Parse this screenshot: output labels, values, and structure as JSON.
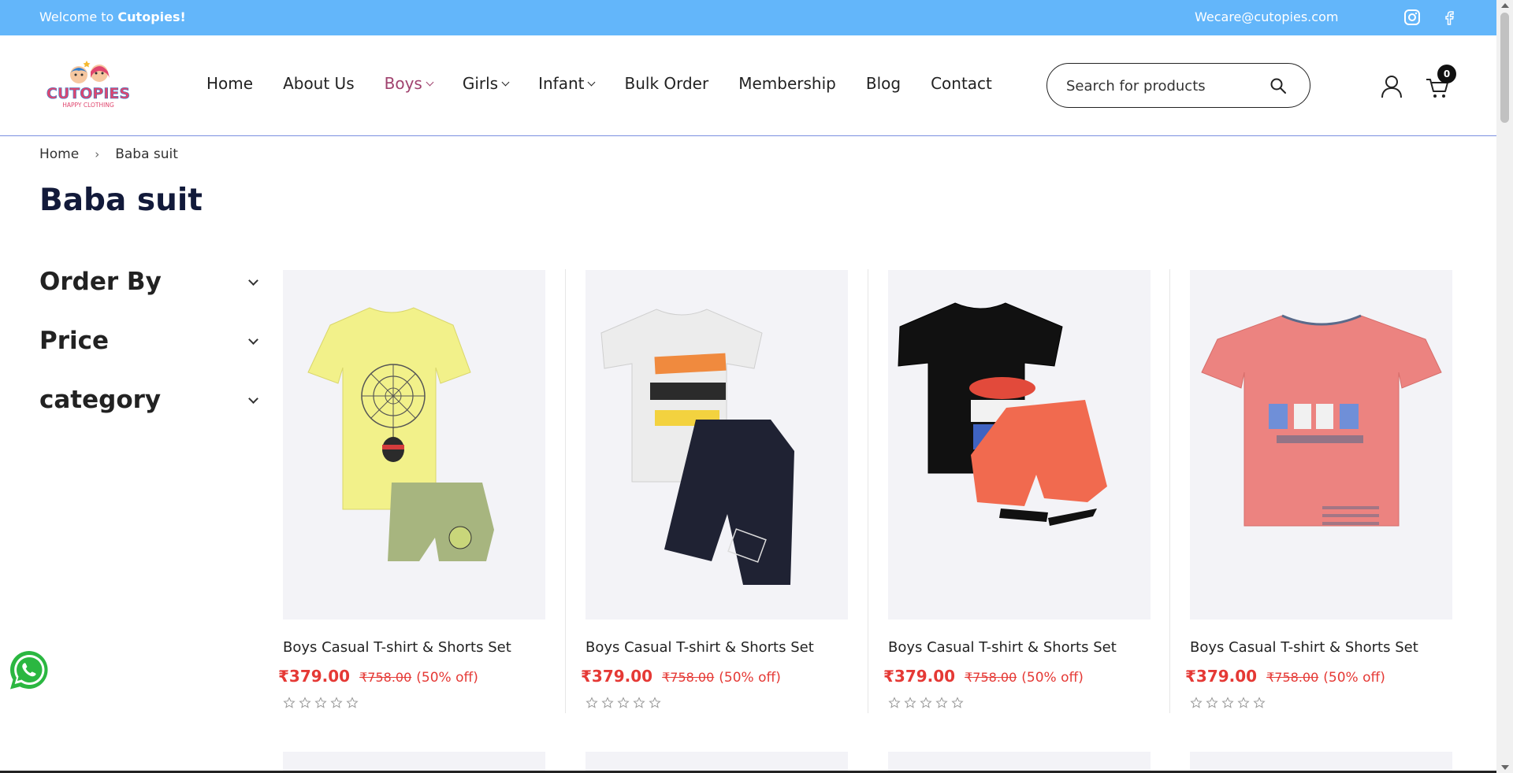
{
  "topbar": {
    "welcome_prefix": "Welcome to ",
    "welcome_brand": "Cutopies!",
    "email": "Wecare@cutopies.com",
    "bg_color": "#63b6fa",
    "icons": [
      "instagram-icon",
      "facebook-icon"
    ]
  },
  "logo": {
    "brand": "CUTOPIES",
    "tagline": "HAPPY CLOTHING"
  },
  "nav": {
    "items": [
      {
        "label": "Home",
        "dropdown": false,
        "active": false
      },
      {
        "label": "About Us",
        "dropdown": false,
        "active": false
      },
      {
        "label": "Boys",
        "dropdown": true,
        "active": true
      },
      {
        "label": "Girls",
        "dropdown": true,
        "active": false
      },
      {
        "label": "Infant",
        "dropdown": true,
        "active": false
      },
      {
        "label": "Bulk Order",
        "dropdown": false,
        "active": false
      },
      {
        "label": "Membership",
        "dropdown": false,
        "active": false
      },
      {
        "label": "Blog",
        "dropdown": false,
        "active": false
      },
      {
        "label": "Contact",
        "dropdown": false,
        "active": false
      }
    ],
    "active_color": "#a0426e"
  },
  "search": {
    "placeholder": "Search for products",
    "value": ""
  },
  "cart": {
    "count": "0"
  },
  "breadcrumb": {
    "home": "Home",
    "separator": "›",
    "current": "Baba suit"
  },
  "page": {
    "title": "Baba suit"
  },
  "filters": [
    {
      "label": "Order By"
    },
    {
      "label": "Price"
    },
    {
      "label": "category"
    }
  ],
  "products": [
    {
      "name": "Boys Casual T-shirt & Shorts Set",
      "price": "₹379.00",
      "old_price": "₹758.00",
      "discount": "(50% off)",
      "rating": 0,
      "shirt_color": "#f2f18a",
      "shorts_color": "#a7b57f"
    },
    {
      "name": "Boys Casual T-shirt & Shorts Set",
      "price": "₹379.00",
      "old_price": "₹758.00",
      "discount": "(50% off)",
      "rating": 0,
      "shirt_color": "#ececec",
      "shorts_color": "#1f2233"
    },
    {
      "name": "Boys Casual T-shirt & Shorts Set",
      "price": "₹379.00",
      "old_price": "₹758.00",
      "discount": "(50% off)",
      "rating": 0,
      "shirt_color": "#111111",
      "shorts_color": "#f16a4f"
    },
    {
      "name": "Boys Casual T-shirt & Shorts Set",
      "price": "₹379.00",
      "old_price": "₹758.00",
      "discount": "(50% off)",
      "rating": 0,
      "shirt_color": "#ec8380",
      "shorts_color": ""
    }
  ],
  "colors": {
    "price_red": "#e53935",
    "title_navy": "#121a3a"
  }
}
